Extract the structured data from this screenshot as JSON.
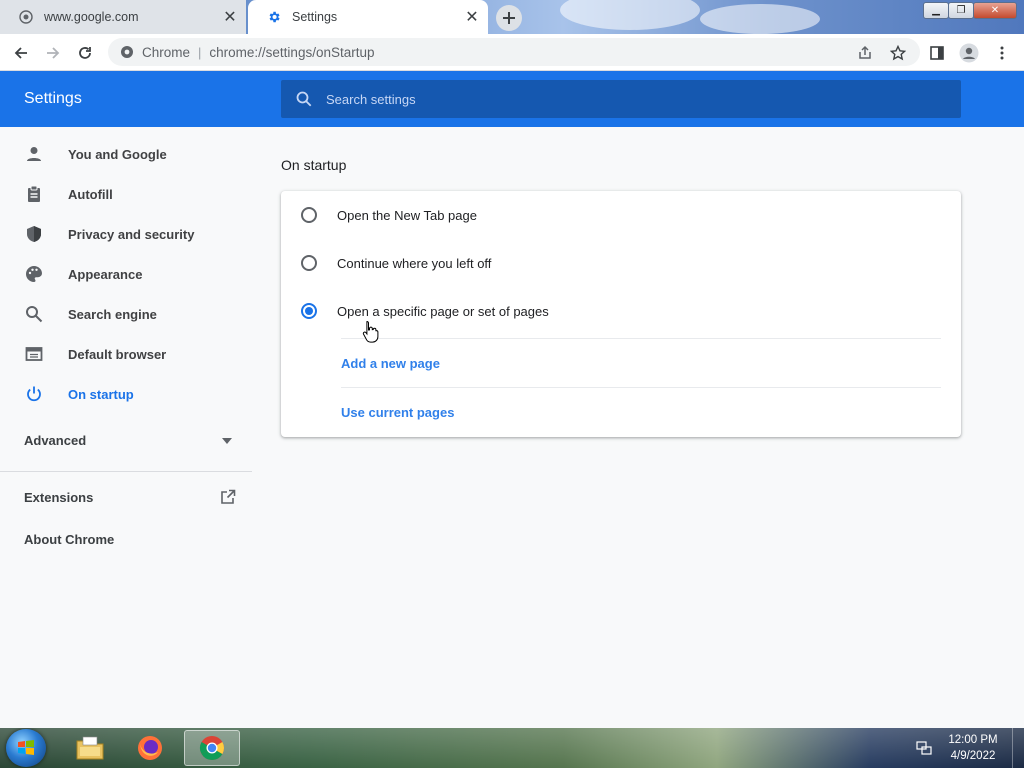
{
  "tabs": [
    {
      "title": "www.google.com",
      "active": false
    },
    {
      "title": "Settings",
      "active": true
    }
  ],
  "omnibox": {
    "chip": "Chrome",
    "separator": "|",
    "url": "chrome://settings/onStartup"
  },
  "header": {
    "title": "Settings",
    "search_placeholder": "Search settings"
  },
  "sidebar": {
    "items": [
      {
        "label": "You and Google",
        "icon": "person-icon"
      },
      {
        "label": "Autofill",
        "icon": "clipboard-icon"
      },
      {
        "label": "Privacy and security",
        "icon": "shield-icon"
      },
      {
        "label": "Appearance",
        "icon": "palette-icon"
      },
      {
        "label": "Search engine",
        "icon": "search-icon"
      },
      {
        "label": "Default browser",
        "icon": "browser-window-icon"
      },
      {
        "label": "On startup",
        "icon": "power-icon",
        "selected": true
      }
    ],
    "advanced": "Advanced",
    "extensions": "Extensions",
    "about": "About Chrome"
  },
  "main": {
    "section_title": "On startup",
    "options": [
      {
        "label": "Open the New Tab page",
        "checked": false
      },
      {
        "label": "Continue where you left off",
        "checked": false
      },
      {
        "label": "Open a specific page or set of pages",
        "checked": true
      }
    ],
    "links": {
      "add": "Add a new page",
      "use_current": "Use current pages"
    }
  },
  "taskbar": {
    "time": "12:00 PM",
    "date": "4/9/2022"
  },
  "colors": {
    "accent": "#1a73e8",
    "header_search": "#1558b0",
    "page_bg": "#f8f9fa"
  }
}
